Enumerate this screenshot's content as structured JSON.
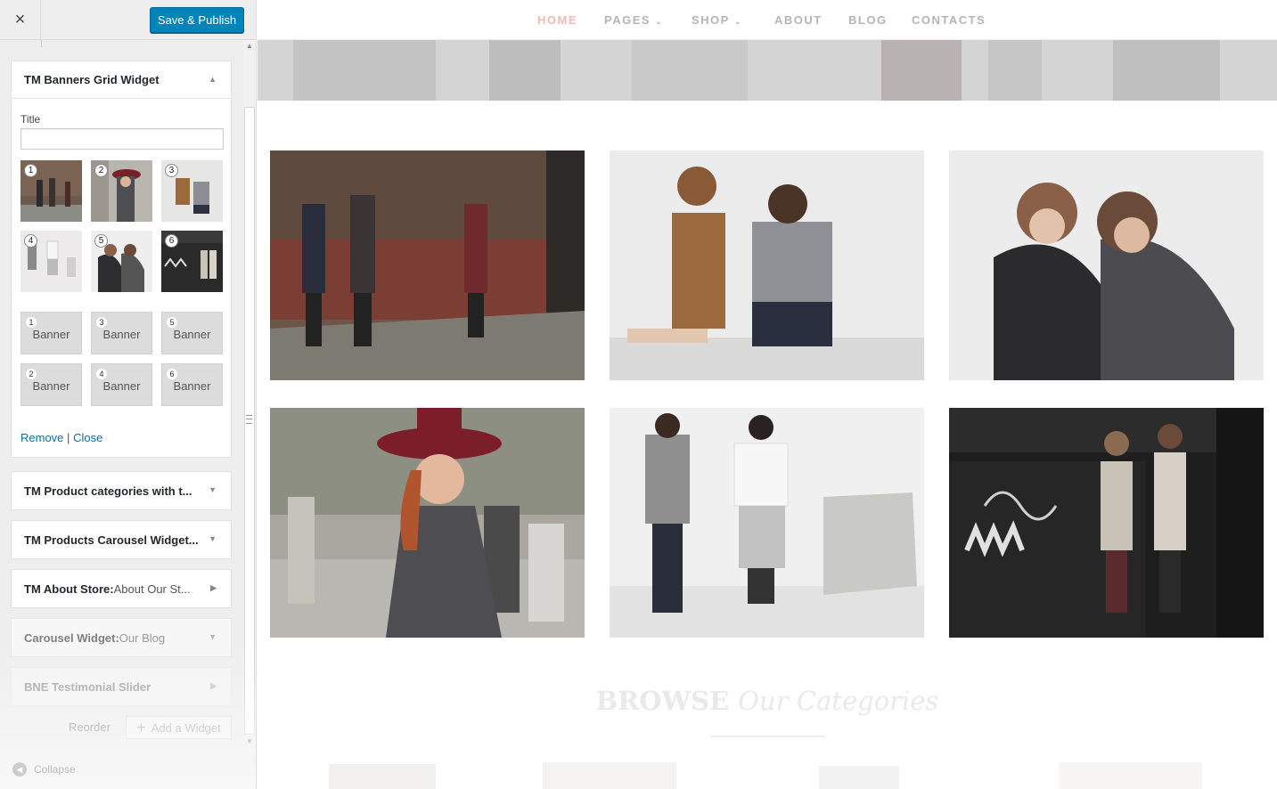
{
  "customizer": {
    "publish_label": "Save & Publish",
    "close_icon": "×",
    "open_widget": {
      "title": "TM Banners Grid Widget",
      "title_field_label": "Title",
      "title_value": "",
      "image_numbers": [
        "1",
        "2",
        "3",
        "4",
        "5",
        "6"
      ],
      "banners": [
        {
          "num": "1",
          "label": "Banner"
        },
        {
          "num": "3",
          "label": "Banner"
        },
        {
          "num": "5",
          "label": "Banner"
        },
        {
          "num": "2",
          "label": "Banner"
        },
        {
          "num": "4",
          "label": "Banner"
        },
        {
          "num": "6",
          "label": "Banner"
        }
      ],
      "remove_label": "Remove",
      "separator": "|",
      "close_label": "Close"
    },
    "widgets": [
      {
        "title": "TM Product categories with t...",
        "sub": ""
      },
      {
        "title": "TM Products Carousel Widget...",
        "sub": ""
      },
      {
        "title": "TM About Store:",
        "sub": " About Our St..."
      },
      {
        "title": "Carousel Widget:",
        "sub": " Our Blog"
      },
      {
        "title": "BNE Testimonial Slider",
        "sub": ""
      }
    ],
    "reorder_label": "Reorder",
    "add_widget_label": "Add a Widget",
    "collapse_label": "Collapse"
  },
  "site": {
    "nav": [
      {
        "label": "HOME",
        "chevron": ""
      },
      {
        "label": "PAGES",
        "chevron": "⌄"
      },
      {
        "label": "SHOP",
        "chevron": "⌄"
      },
      {
        "label": "ABOUT",
        "chevron": ""
      },
      {
        "label": "BLOG",
        "chevron": ""
      },
      {
        "label": "CONTACTS",
        "chevron": ""
      }
    ],
    "browse_title_bold": "BROWSE",
    "browse_title_italic": "Our Categories"
  },
  "colors": {
    "publish": "#0085ba",
    "link": "#0073aa",
    "nav_active": "#f4b8b4",
    "nav": "#b5b5b5"
  }
}
